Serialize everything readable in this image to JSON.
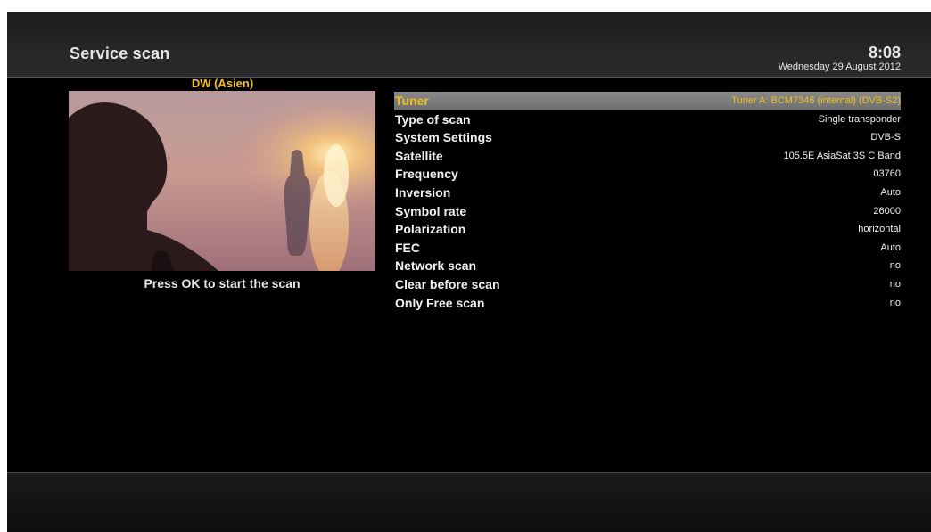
{
  "header": {
    "title": "Service scan",
    "time": "8:08",
    "date": "Wednesday 29 August 2012"
  },
  "preview": {
    "channel_name": "DW (Asien)",
    "hint": "Press OK to start the scan"
  },
  "settings": [
    {
      "label": "Tuner",
      "value": "Tuner A: BCM7346 (internal) (DVB-S2)",
      "selected": true
    },
    {
      "label": "Type of scan",
      "value": "Single transponder"
    },
    {
      "label": "System Settings",
      "value": "DVB-S"
    },
    {
      "label": "Satellite",
      "value": "105.5E AsiaSat 3S C Band"
    },
    {
      "label": "Frequency",
      "value": "03760"
    },
    {
      "label": "Inversion",
      "value": "Auto"
    },
    {
      "label": "Symbol rate",
      "value": "26000"
    },
    {
      "label": "Polarization",
      "value": "horizontal"
    },
    {
      "label": "FEC",
      "value": "Auto"
    },
    {
      "label": "Network scan",
      "value": "no"
    },
    {
      "label": "Clear before scan",
      "value": "no"
    },
    {
      "label": "Only Free scan",
      "value": "no"
    }
  ],
  "colors": {
    "highlight_text": "#f0c020",
    "text": "#f0f0f0",
    "background": "#000000"
  }
}
